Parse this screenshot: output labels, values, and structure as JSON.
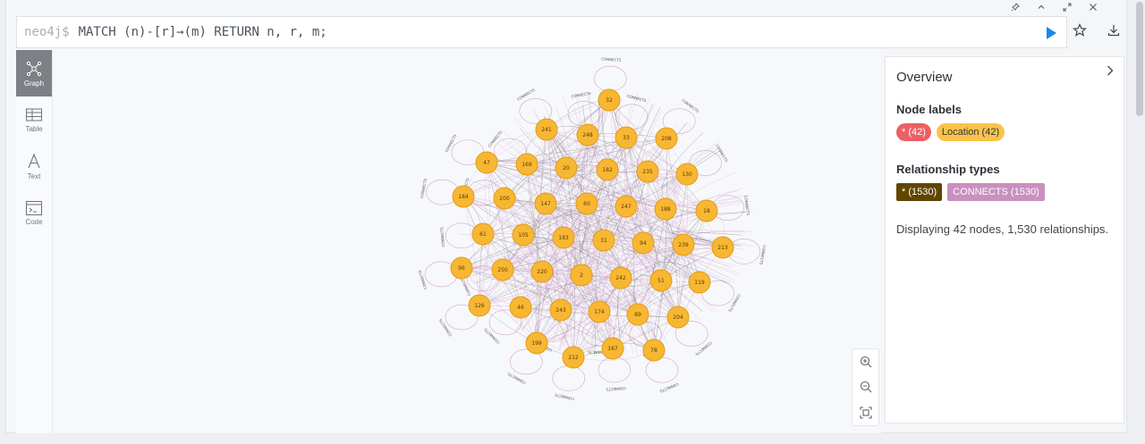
{
  "editor": {
    "prompt": "neo4j$",
    "query": "MATCH (n)-[r]→(m) RETURN n, r, m;"
  },
  "window_controls": [
    "pin-icon",
    "chevron-up-icon",
    "expand-icon",
    "close-icon"
  ],
  "side_actions": [
    "star-icon",
    "download-icon"
  ],
  "views": [
    {
      "label": "Graph",
      "icon": "graph-icon",
      "active": true
    },
    {
      "label": "Table",
      "icon": "table-icon",
      "active": false
    },
    {
      "label": "Text",
      "icon": "text-icon",
      "active": false
    },
    {
      "label": "Code",
      "icon": "code-icon",
      "active": false
    }
  ],
  "overview": {
    "title": "Overview",
    "node_labels_heading": "Node labels",
    "node_labels": [
      {
        "text": "* (42)",
        "color": "#ec6064"
      },
      {
        "text": "Location (42)",
        "color": "#f9c34b"
      }
    ],
    "rel_types_heading": "Relationship types",
    "rel_types": [
      {
        "text": "* (1530)",
        "color": "#5f4600"
      },
      {
        "text": "CONNECTS (1530)",
        "color": "#c990c0"
      }
    ],
    "summary": "Displaying 42 nodes, 1,530 relationships."
  },
  "graph": {
    "node_color": "#f7b733",
    "edge_color": "#c990c0",
    "edge_label": "CONNECTS",
    "nodes": [
      "32",
      "241",
      "248",
      "33",
      "208",
      "47",
      "169",
      "20",
      "182",
      "235",
      "130",
      "184",
      "200",
      "147",
      "60",
      "247",
      "188",
      "18",
      "61",
      "105",
      "183",
      "31",
      "94",
      "239",
      "213",
      "96",
      "250",
      "220",
      "2",
      "242",
      "51",
      "119",
      "126",
      "46",
      "243",
      "174",
      "89",
      "204",
      "199",
      "212",
      "167",
      "78"
    ]
  },
  "zoom": [
    "zoom-in-icon",
    "zoom-out-icon",
    "fit-icon"
  ]
}
